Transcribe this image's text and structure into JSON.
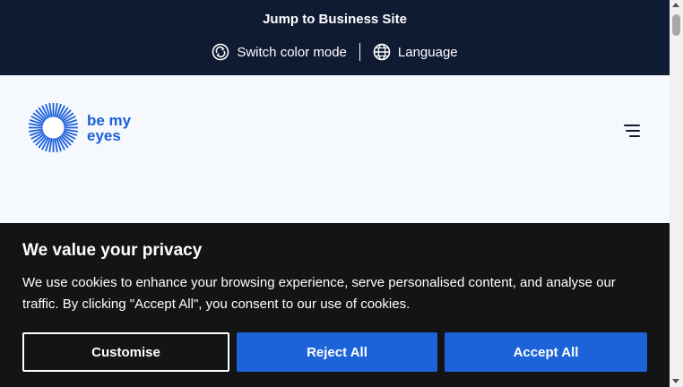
{
  "top_bar": {
    "business_link": "Jump to Business Site",
    "color_mode_label": "Switch color mode",
    "language_label": "Language"
  },
  "header": {
    "logo_line1": "be my",
    "logo_line2": "eyes"
  },
  "cookie_banner": {
    "title": "We value your privacy",
    "body": "We use cookies to enhance your browsing experience, serve personalised content, and analyse our traffic. By clicking \"Accept All\", you consent to our use of cookies.",
    "customise_label": "Customise",
    "reject_label": "Reject All",
    "accept_label": "Accept All"
  },
  "colors": {
    "top_bar_bg": "#0f1a33",
    "brand_blue": "#1b5fd9",
    "button_blue": "#1c63d9",
    "cookie_bg": "#141414"
  },
  "icons": [
    "color-mode-icon",
    "globe-icon",
    "sunburst-logo-icon",
    "hamburger-menu-icon"
  ]
}
